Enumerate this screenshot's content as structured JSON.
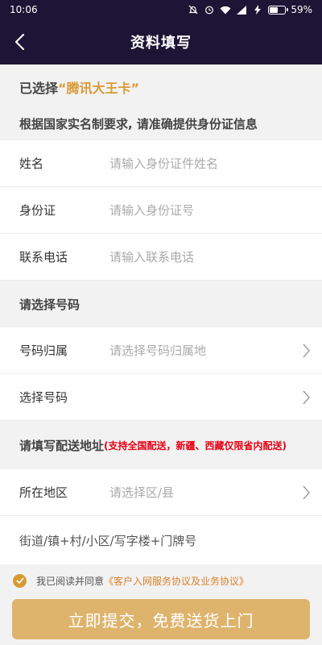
{
  "status_bar": {
    "time": "10:06",
    "battery": "59%",
    "battery_level": 0.59,
    "icons": [
      "bell-muted-icon",
      "alarm-icon",
      "wifi-icon",
      "hd-signal-icon",
      "charging-icon",
      "battery-icon"
    ]
  },
  "header": {
    "title": "资料填写",
    "back_icon": "chevron-left-icon"
  },
  "selection": {
    "prefix": "已选择",
    "card_name": "“腾讯大王卡”",
    "notice": "根据国家实名制要求, 请准确提供身份证信息"
  },
  "identity_fields": [
    {
      "label": "姓名",
      "placeholder": "请输入身份证件姓名"
    },
    {
      "label": "身份证",
      "placeholder": "请输入身份证号"
    },
    {
      "label": "联系电话",
      "placeholder": "请输入联系电话"
    }
  ],
  "number_section": {
    "title": "请选择号码",
    "fields": [
      {
        "label": "号码归属",
        "placeholder": "请选择号码归属地"
      },
      {
        "label": "选择号码",
        "placeholder": ""
      }
    ]
  },
  "address_section": {
    "title": "请填写配送地址",
    "note": "(支持全国配送，新疆、西藏仅限省内配送)",
    "region_label": "所在地区",
    "region_placeholder": "请选择区/县",
    "street_placeholder": "街道/镇+村/小区/写字楼+门牌号"
  },
  "agreement": {
    "text": "我已阅读并同意",
    "link": "《客户入网服务协议及业务协议》",
    "checked": true
  },
  "submit_label": "立即提交，免费送货上门",
  "colors": {
    "header_bg": "#1c1535",
    "accent": "#d99a36",
    "button": "#deb46d",
    "note_red": "#e60012"
  }
}
